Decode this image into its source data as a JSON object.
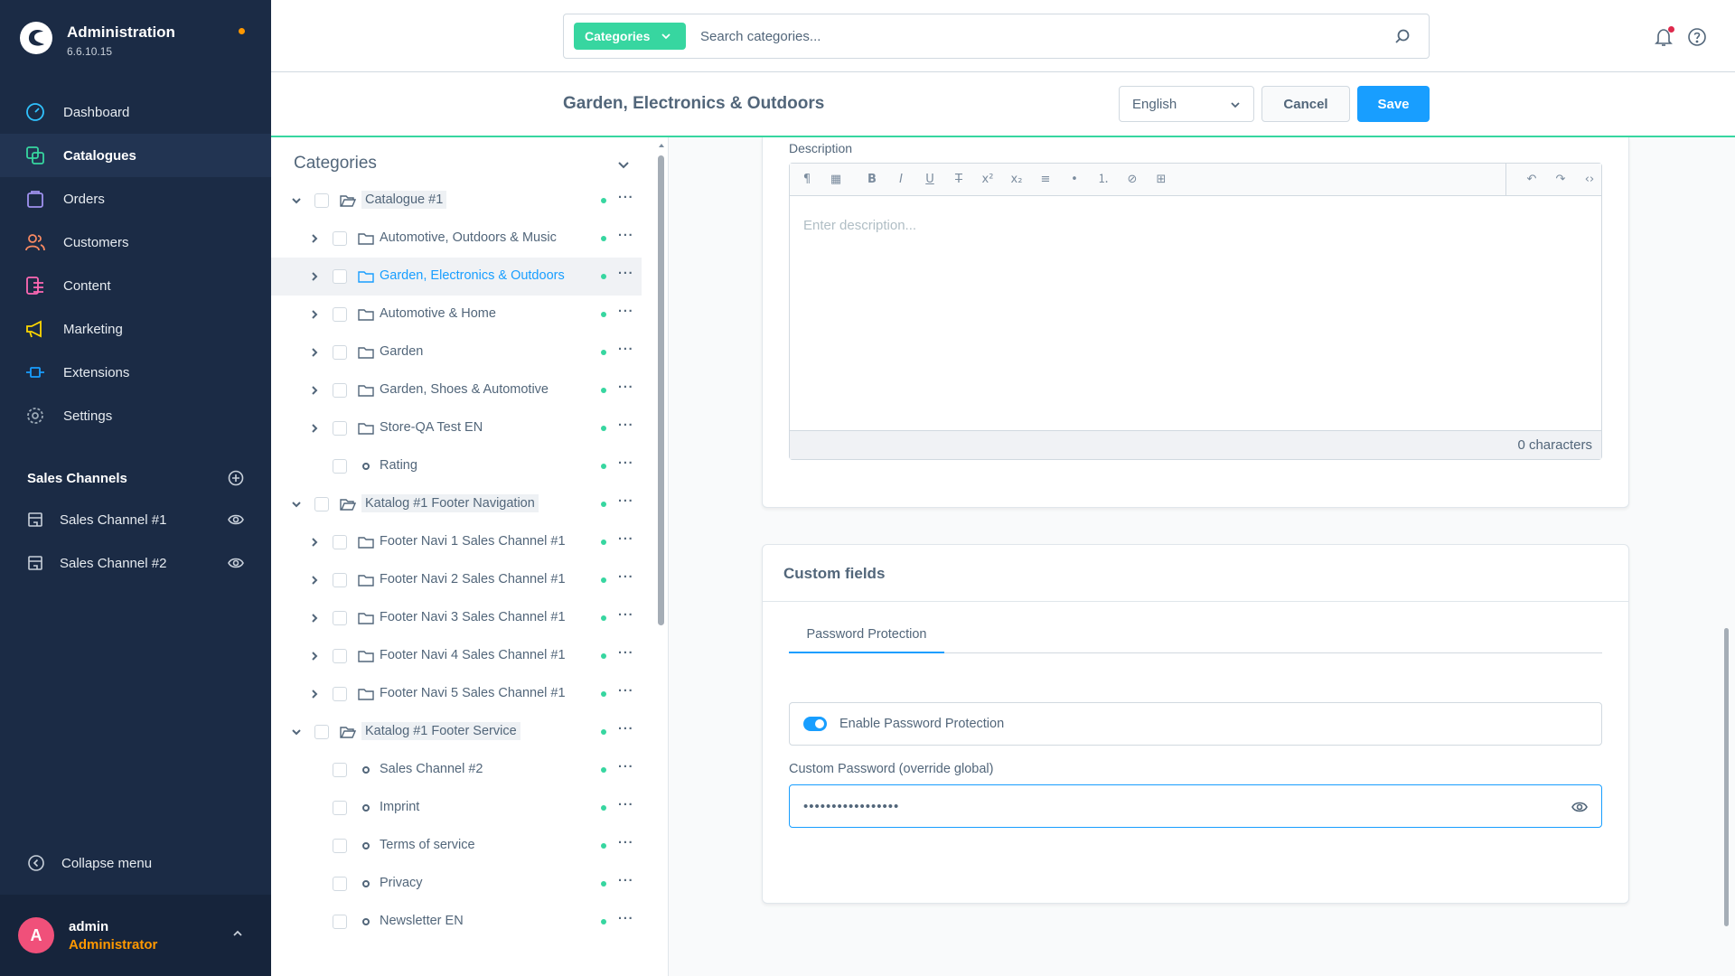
{
  "brand": {
    "title": "Administration",
    "version": "6.6.10.15"
  },
  "nav": [
    {
      "label": "Dashboard",
      "icon": "dashboard-icon",
      "color": "#30c2ff"
    },
    {
      "label": "Catalogues",
      "icon": "catalogue-icon",
      "color": "#37d6a0",
      "active": true
    },
    {
      "label": "Orders",
      "icon": "orders-icon",
      "color": "#a092f0"
    },
    {
      "label": "Customers",
      "icon": "customers-icon",
      "color": "#f88962"
    },
    {
      "label": "Content",
      "icon": "content-icon",
      "color": "#ff68b4"
    },
    {
      "label": "Marketing",
      "icon": "marketing-icon",
      "color": "#ffd700"
    },
    {
      "label": "Extensions",
      "icon": "extensions-icon",
      "color": "#189eff"
    },
    {
      "label": "Settings",
      "icon": "settings-icon",
      "color": "#9aa8b5"
    }
  ],
  "sales_channels": {
    "title": "Sales Channels",
    "items": [
      {
        "label": "Sales Channel #1"
      },
      {
        "label": "Sales Channel #2"
      }
    ]
  },
  "collapse_label": "Collapse menu",
  "user": {
    "initial": "A",
    "name": "admin",
    "role": "Administrator"
  },
  "search": {
    "type_label": "Categories",
    "placeholder": "Search categories..."
  },
  "header": {
    "title": "Garden, Electronics & Outdoors",
    "language": "English",
    "cancel": "Cancel",
    "save": "Save"
  },
  "tree": {
    "title": "Categories",
    "rows": [
      {
        "label": "Catalogue #1",
        "level": 0,
        "expanded": true,
        "icon": "folder-open-icon"
      },
      {
        "label": "Automotive, Outdoors & Music",
        "level": 1,
        "toggle": true,
        "icon": "folder-icon"
      },
      {
        "label": "Garden, Electronics & Outdoors",
        "level": 1,
        "toggle": true,
        "icon": "folder-icon",
        "selected": true
      },
      {
        "label": "Automotive & Home",
        "level": 1,
        "toggle": true,
        "icon": "folder-icon"
      },
      {
        "label": "Garden",
        "level": 1,
        "toggle": true,
        "icon": "folder-icon"
      },
      {
        "label": "Garden, Shoes & Automotive",
        "level": 1,
        "toggle": true,
        "icon": "folder-icon"
      },
      {
        "label": "Store-QA Test EN",
        "level": 1,
        "toggle": true,
        "icon": "folder-icon"
      },
      {
        "label": "Rating",
        "level": 1,
        "toggle": false,
        "icon": "leaf-icon"
      },
      {
        "label": "Katalog #1 Footer Navigation",
        "level": 0,
        "expanded": true,
        "icon": "folder-open-icon"
      },
      {
        "label": "Footer Navi 1 Sales Channel #1",
        "level": 1,
        "toggle": true,
        "icon": "folder-icon"
      },
      {
        "label": "Footer Navi 2 Sales Channel #1",
        "level": 1,
        "toggle": true,
        "icon": "folder-icon"
      },
      {
        "label": "Footer Navi 3 Sales Channel #1",
        "level": 1,
        "toggle": true,
        "icon": "folder-icon"
      },
      {
        "label": "Footer Navi 4 Sales Channel #1",
        "level": 1,
        "toggle": true,
        "icon": "folder-icon"
      },
      {
        "label": "Footer Navi 5 Sales Channel #1",
        "level": 1,
        "toggle": true,
        "icon": "folder-icon"
      },
      {
        "label": "Katalog #1 Footer Service",
        "level": 0,
        "expanded": true,
        "icon": "folder-open-icon"
      },
      {
        "label": "Sales Channel #2",
        "level": 1,
        "toggle": false,
        "icon": "leaf-icon"
      },
      {
        "label": "Imprint",
        "level": 1,
        "toggle": false,
        "icon": "leaf-icon"
      },
      {
        "label": "Terms of service",
        "level": 1,
        "toggle": false,
        "icon": "leaf-icon"
      },
      {
        "label": "Privacy",
        "level": 1,
        "toggle": false,
        "icon": "leaf-icon"
      },
      {
        "label": "Newsletter EN",
        "level": 1,
        "toggle": false,
        "icon": "leaf-icon"
      }
    ]
  },
  "description": {
    "label": "Description",
    "placeholder": "Enter description...",
    "counter": "0 characters"
  },
  "custom_fields": {
    "title": "Custom fields",
    "tab": "Password Protection",
    "toggle_label": "Enable Password Protection",
    "toggle_on": true,
    "password_label": "Custom Password (override global)",
    "password_value": "•••••••••••••••••"
  },
  "colors": {
    "sidebar": "#1b2b45",
    "accent": "#189eff",
    "brand_green": "#37d6a0"
  }
}
